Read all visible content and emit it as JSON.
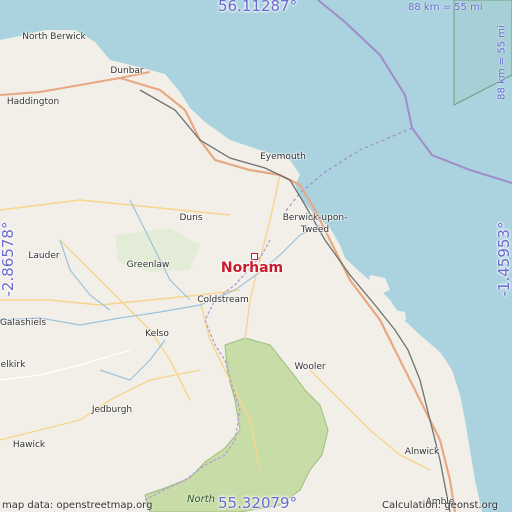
{
  "map": {
    "place_name": "Norham",
    "coords": {
      "top": "56.11287°",
      "bottom": "55.32079°",
      "left": "-2.86578°",
      "right": "-1.45953°"
    },
    "scale": {
      "horizontal": "88 km = 55 mi",
      "vertical": "88 km = 55 mi"
    },
    "attribution": {
      "data": "map data: openstreetmap.org",
      "calc": "Calculation: geonst.org"
    },
    "park_label": "North",
    "towns": {
      "north_berwick": "North Berwick",
      "dunbar": "Dunbar",
      "haddington": "Haddington",
      "eyemouth": "Eyemouth",
      "duns": "Duns",
      "berwick_1": "Berwick-upon-",
      "berwick_2": "Tweed",
      "lauder": "Lauder",
      "greenlaw": "Greenlaw",
      "coldstream": "Coldstream",
      "galashiels": "Galashiels",
      "kelso": "Kelso",
      "wooler": "Wooler",
      "selkirk": "elkirk",
      "jedburgh": "Jedburgh",
      "hawick": "Hawick",
      "alnwick": "Alnwick",
      "amble": "Amble"
    },
    "colors": {
      "sea": "#aad3df",
      "land": "#f2efe9",
      "park": "#c8dca8",
      "marker": "#c81c2c",
      "coord_text": "#6a6ad0"
    }
  }
}
